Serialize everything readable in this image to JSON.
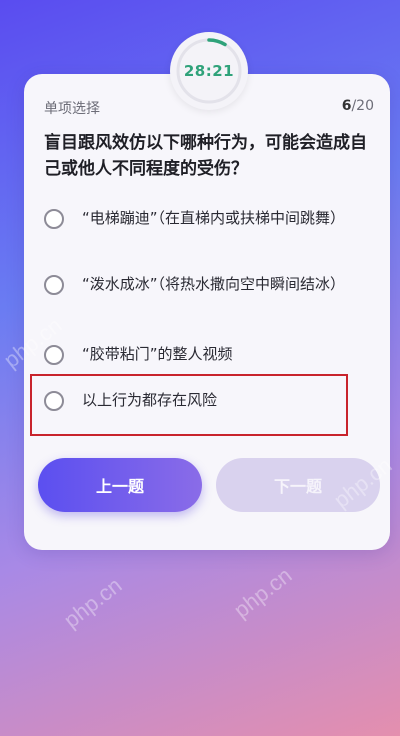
{
  "timer": {
    "value": "28:21"
  },
  "quiz": {
    "section_label": "单项选择",
    "progress_current": "6",
    "progress_total": "/20",
    "question": "盲目跟风效仿以下哪种行为，可能会造成自己或他人不同程度的受伤？",
    "options": [
      {
        "text": "“电梯蹦迪”（在直梯内或扶梯中间跳舞）"
      },
      {
        "text": "“泼水成冰”（将热水撒向空中瞬间结冰）"
      },
      {
        "text": "“胶带粘门”的整人视频"
      },
      {
        "text": "以上行为都存在风险"
      }
    ]
  },
  "buttons": {
    "prev_label": "上一题",
    "next_label": "下一题"
  },
  "watermark": {
    "text": "php.cn"
  },
  "colors": {
    "timer_text": "#2fa27a",
    "highlight_border": "#c8232c",
    "prev_button": "#5b4ff0",
    "next_button": "#d9d2ee"
  }
}
